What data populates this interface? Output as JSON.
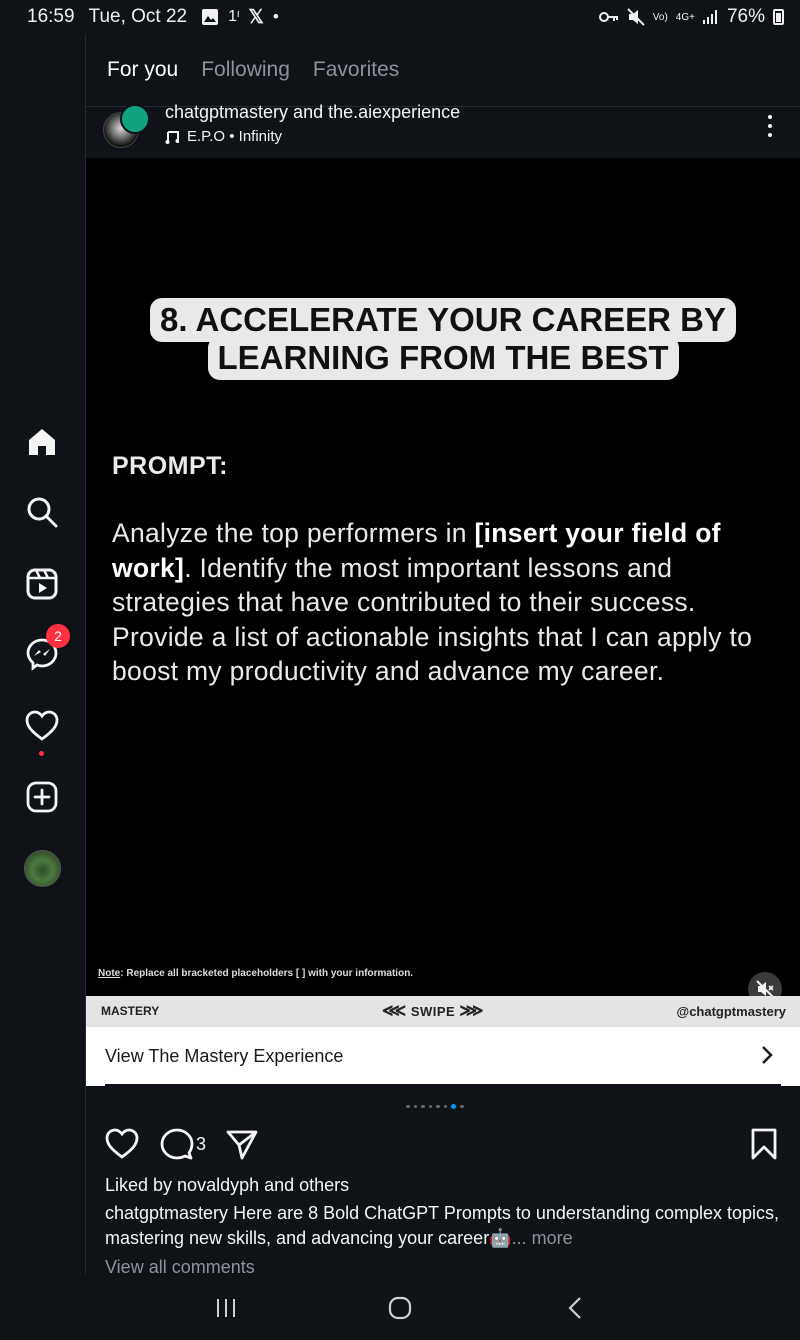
{
  "status_bar": {
    "time": "16:59",
    "date": "Tue, Oct 22",
    "battery": "76%",
    "network_label_1": "Vo)",
    "network_label_2": "4G+"
  },
  "feed_tabs": [
    {
      "label": "For you",
      "active": true
    },
    {
      "label": "Following",
      "active": false
    },
    {
      "label": "Favorites",
      "active": false
    }
  ],
  "sidebar": {
    "items": [
      {
        "icon": "home-icon"
      },
      {
        "icon": "search-icon"
      },
      {
        "icon": "reels-icon"
      },
      {
        "icon": "messenger-icon",
        "badge": "2"
      },
      {
        "icon": "heart-icon"
      },
      {
        "icon": "create-icon"
      },
      {
        "icon": "profile-avatar"
      }
    ]
  },
  "post": {
    "usernames": "chatgptmastery and the.aiexperience",
    "music": "E.P.O • Infinity",
    "media": {
      "headline_line1": "8. ACCELERATE YOUR CAREER BY",
      "headline_line2": "LEARNING FROM THE BEST",
      "prompt_label": "PROMPT:",
      "prompt_text_1": "Analyze the top performers in ",
      "prompt_bold": "[insert your field of work]",
      "prompt_text_2": ". Identify the most important lessons and strategies that have contributed to their success. Provide a list of actionable insights that I can apply to boost my productivity and advance my career.",
      "note_label": "Note",
      "note_text": ": Replace all bracketed placeholders [ ] with your information.",
      "footer_left": "MASTERY",
      "footer_center": "SWIPE",
      "footer_right": "@chatgptmastery"
    },
    "cta_label": "View The Mastery Experience",
    "carousel": {
      "count": 8,
      "active_index": 6
    },
    "comment_count": "3",
    "likes_text": "Liked by novaldyph and others",
    "caption_user": "chatgptmastery",
    "caption_text": " Here are 8 Bold ChatGPT Prompts to understanding complex topics, mastering new skills, and advancing your career🤖",
    "caption_more": "... more",
    "view_comments": "View all comments"
  },
  "colors": {
    "background": "#0f1216",
    "badge_red": "#ff3040",
    "active_dot": "#0095f6"
  }
}
